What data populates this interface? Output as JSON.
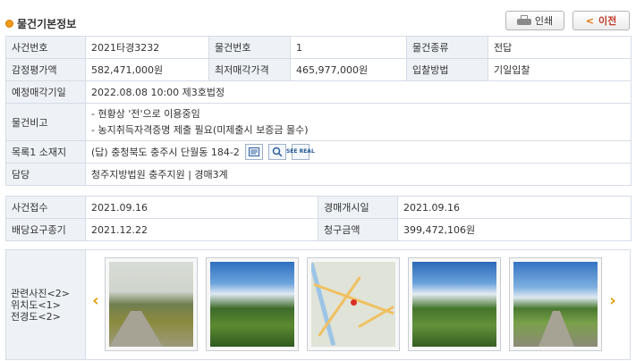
{
  "header": {
    "title": "물건기본정보",
    "print_label": "인쇄",
    "prev_label": "이전"
  },
  "case_info": {
    "case_no_label": "사건번호",
    "case_no": "2021타경3232",
    "item_no_label": "물건번호",
    "item_no": "1",
    "item_type_label": "물건종류",
    "item_type": "전답",
    "appraisal_label": "감정평가액",
    "appraisal": "582,471,000원",
    "min_price_label": "최저매각가격",
    "min_price": "465,977,000원",
    "bid_method_label": "입찰방법",
    "bid_method": "기일입찰",
    "sale_date_label": "예정매각기일",
    "sale_date": "2022.08.08 10:00 제3호법정",
    "notes_label": "물건비고",
    "notes": [
      "- 현황상 '전'으로 이용중임",
      "- 농지취득자격증명 제출 필요(미제출시 보증금 몰수)"
    ],
    "address_label": "목록1 소재지",
    "address": "(답) 충청북도 충주시 단월동 184-2",
    "see_real_label": "SEE REAL",
    "court_label": "담당",
    "court": "청주지방법원 충주지원 | 경매3계"
  },
  "case_dates": {
    "received_label": "사건접수",
    "received": "2021.09.16",
    "start_label": "경매개시일",
    "start": "2021.09.16",
    "claim_deadline_label": "배당요구종기",
    "claim_deadline": "2021.12.22",
    "claim_amount_label": "청구금액",
    "claim_amount": "399,472,106원"
  },
  "gallery": {
    "labels": [
      "관련사진<2>",
      "위치도<1>",
      "전경도<2>"
    ]
  }
}
